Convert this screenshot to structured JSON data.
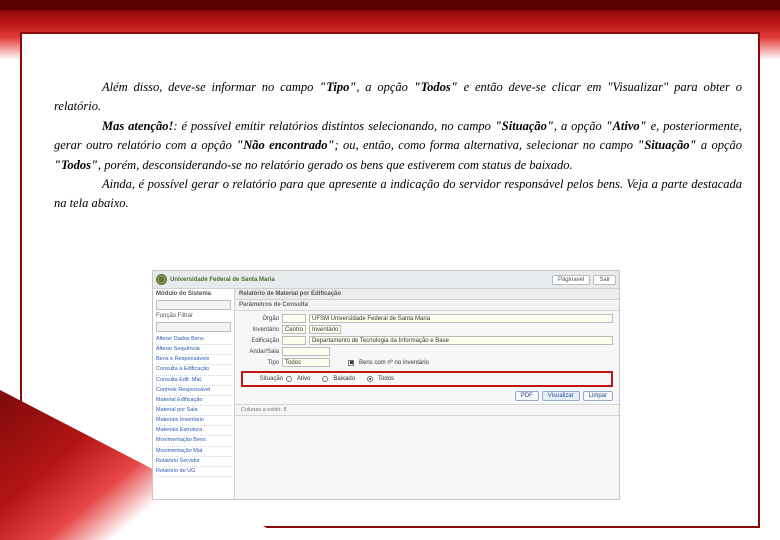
{
  "para1": {
    "a": "Além disso, deve-se informar no campo ",
    "tipo": "\"Tipo\"",
    "b": ", a opção ",
    "todos": "\"Todos\"",
    "c": " e então deve-se clicar em \"Visualizar\" para obter o relatório."
  },
  "para2": {
    "warn": "Mas atenção!",
    "a": ": é possível emitir relatórios distintos selecionando, no campo ",
    "sit": "\"Situação\"",
    "b": ", a opção ",
    "ativo": "\"Ativo\"",
    "c": " e, posteriormente, gerar outro relatório com a opção ",
    "naoenc": "\"Não encontrado\"",
    "d": "; ou, então, como forma alternativa, selecionar no campo ",
    "sit2": "\"Situação\"",
    "e": " a opção ",
    "todos": "\"Todos\"",
    "f": ", porém, desconsiderando-se no relatório gerado os bens que estiverem com status de baixado."
  },
  "para3": "Ainda, é possível gerar o relatório para que apresente a indicação do servidor responsável pelos bens. Veja a parte destacada na tela abaixo.",
  "shot": {
    "org": "Universidade Federal de Santa Maria",
    "btn_printable": "Páginavel",
    "btn_exit": "Sair",
    "sidebar": {
      "header": "Módulo do Sistema",
      "filter": "Função  Filtrar",
      "links": [
        "Alterar Dados Bens",
        "Alterar Sequência",
        "Bens e Responsáveis",
        "Consulta à Edificação ",
        "Consulta Edif. Mat.",
        "Controle Responsável",
        "Material Edificação",
        "Material por Sala",
        "Materiais Inventário",
        "Materiais Estrutura",
        "Movimentação Bens",
        "Movimentação Mat.",
        "Relatório Servidor",
        "Relatório de UG"
      ]
    },
    "panel_title": "Relatório de Material por Edificação",
    "sub_title": "Parâmetros de Consulta",
    "form": {
      "orgao_lbl": "Órgão",
      "orgao_v": "UFSM   Universidade Federal de Santa Maria",
      "inv_lbl": "Inventário",
      "inv_a": "Centro",
      "inv_b": "Inventário",
      "edif_lbl": "Edificação",
      "edif_v": "          Departamento de Tecnologia da Informação e Base",
      "andar_lbl": "Andar/Sala",
      "andar_v": "",
      "tipo_lbl": "Tipo",
      "tipo_v": "Todos",
      "chk_bens": "Bens com nº no inventário",
      "hl_lbl": "Situação",
      "r1": "Ativo",
      "r2": "Baixado",
      "r3": "Todos",
      "btn_pdf": "PDF",
      "btn_view": "Visualizar",
      "btn_clean": "Limpar"
    },
    "columns_note": "Colunas a exibir: 8"
  }
}
